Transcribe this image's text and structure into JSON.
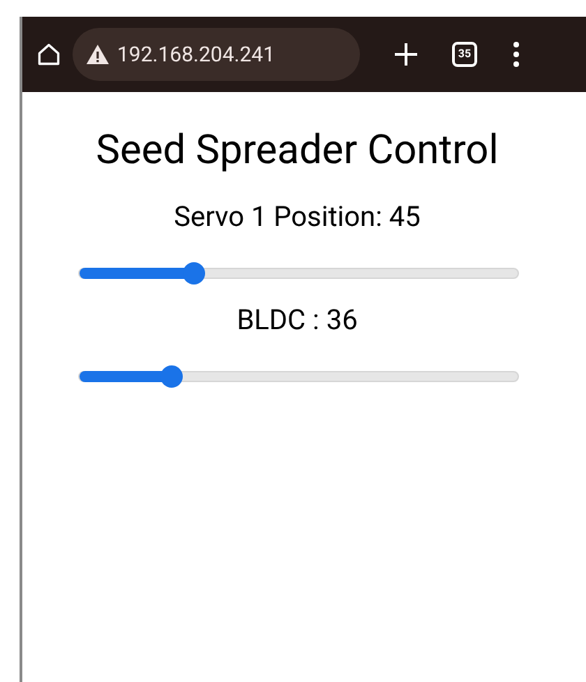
{
  "browser": {
    "url": "192.168.204.241",
    "tab_count": "35"
  },
  "page": {
    "title": "Seed Spreader Control",
    "sliders": [
      {
        "label": "Servo 1 Position: 45",
        "level": 0.26
      },
      {
        "label": "BLDC : 36",
        "level": 0.21
      }
    ]
  }
}
